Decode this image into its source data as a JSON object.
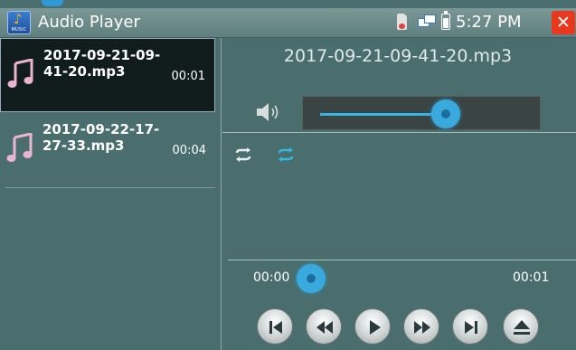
{
  "app": {
    "title": "Audio Player",
    "icon": "music-note-icon",
    "icon_caption": "MUSIC",
    "accent": "#34b6e8"
  },
  "status_bar": {
    "time": "5:27 PM",
    "icons": [
      "sd-card-icon",
      "network-icon",
      "battery-icon",
      "close-icon"
    ]
  },
  "playlist": {
    "items": [
      {
        "name": "2017-09-21-09-41-20.mp3",
        "line1": "2017-09-21-09-",
        "line2": "41-20.mp3",
        "duration": "00:01",
        "selected": true
      },
      {
        "name": "2017-09-22-17-27-33.mp3",
        "line1": "2017-09-22-17-",
        "line2": "27-33.mp3",
        "duration": "00:04",
        "selected": false
      }
    ]
  },
  "player": {
    "now_playing": "2017-09-21-09-41-20.mp3",
    "volume_fraction": 0.6,
    "repeat_modes": [
      "repeat-all-icon",
      "repeat-one-icon"
    ],
    "current_time": "00:00",
    "total_time": "00:01",
    "seek_fraction": 0.0,
    "controls": [
      "skip-previous-icon",
      "rewind-icon",
      "play-icon",
      "fast-forward-icon",
      "skip-next-icon",
      "eject-icon"
    ]
  }
}
